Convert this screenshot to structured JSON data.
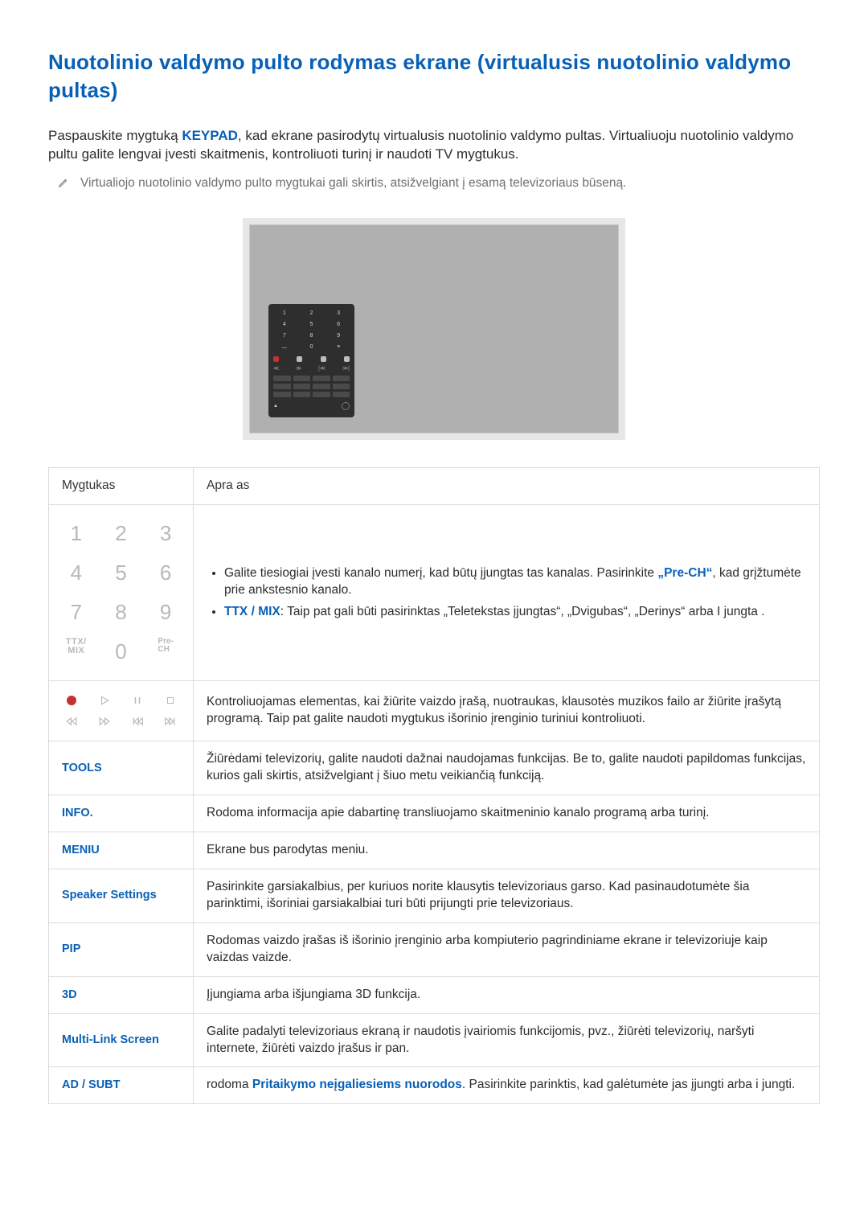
{
  "title": "Nuotolinio valdymo pulto rodymas ekrane (virtualusis nuotolinio valdymo pultas)",
  "intro": {
    "before_keypad": "Paspauskite mygtuką ",
    "keypad": "KEYPAD",
    "after_keypad": ", kad ekrane pasirodytų virtualusis nuotolinio valdymo pultas. Virtualiuoju nuotolinio valdymo pultu galite lengvai įvesti skaitmenis, kontroliuoti turinį ir naudoti TV mygtukus."
  },
  "note": "Virtualiojo nuotolinio valdymo pulto mygtukai gali skirtis, atsižvelgiant į esamą televizoriaus būseną.",
  "table": {
    "headers": {
      "col1": "Mygtukas",
      "col2": "Apra as"
    },
    "numpad_desc": {
      "line1_before": "Galite tiesiogiai įvesti kanalo numerį, kad būtų įjungtas tas kanalas. Pasirinkite ",
      "prech_quoted": "„Pre-CH“",
      "line1_after": ", kad grįžtumėte prie ankstesnio kanalo.",
      "line2_label": "TTX / MIX",
      "line2_rest": ": Taip pat gali būti pasirinktas „Teletekstas įjungtas“, „Dvigubas“, „Derinys“ arba I jungta ."
    },
    "playback_desc": "Kontroliuojamas elementas, kai žiūrite vaizdo įrašą, nuotraukas, klausotės muzikos failo ar žiūrite įrašytą programą. Taip pat galite naudoti mygtukus išorinio įrenginio turiniui kontroliuoti.",
    "rows": [
      {
        "label": "TOOLS",
        "desc": "Žiūrėdami televizorių, galite naudoti dažnai naudojamas funkcijas. Be to, galite naudoti papildomas funkcijas, kurios gali skirtis, atsižvelgiant į šiuo metu veikiančią funkciją."
      },
      {
        "label": "INFO.",
        "desc": "Rodoma informacija apie dabartinę transliuojamo skaitmeninio kanalo programą arba turinį."
      },
      {
        "label": "MENIU",
        "desc": "Ekrane bus parodytas meniu."
      },
      {
        "label": "Speaker Settings",
        "desc": "Pasirinkite garsiakalbius, per kuriuos norite klausytis televizoriaus garso. Kad pasinaudotumėte šia parinktimi, išoriniai garsiakalbiai turi būti prijungti prie televizoriaus."
      },
      {
        "label": "PIP",
        "desc": "Rodomas vaizdo įrašas iš išorinio įrenginio arba kompiuterio pagrindiniame ekrane ir televizoriuje kaip vaizdas vaizde."
      },
      {
        "label": "3D",
        "desc": "Įjungiama arba išjungiama 3D funkcija."
      },
      {
        "label": "Multi-Link Screen",
        "desc": "Galite padalyti televizoriaus ekraną ir naudotis įvairiomis funkcijomis, pvz., žiūrėti televizorių, naršyti internete, žiūrėti vaizdo įrašus ir pan."
      }
    ],
    "adsubt": {
      "label": "AD / SUBT",
      "before_blue": "rodoma ",
      "blue_text": "Pritaikymo neįgaliesiems nuorodos",
      "after_blue": ". Pasirinkite parinktis, kad galėtumėte jas įjungti arba i jungti."
    }
  },
  "keypad": {
    "keys": [
      "1",
      "2",
      "3",
      "4",
      "5",
      "6",
      "7",
      "8",
      "9"
    ],
    "ttx": "TTX/\nMIX",
    "zero": "0",
    "prech": "Pre-\nCH"
  }
}
